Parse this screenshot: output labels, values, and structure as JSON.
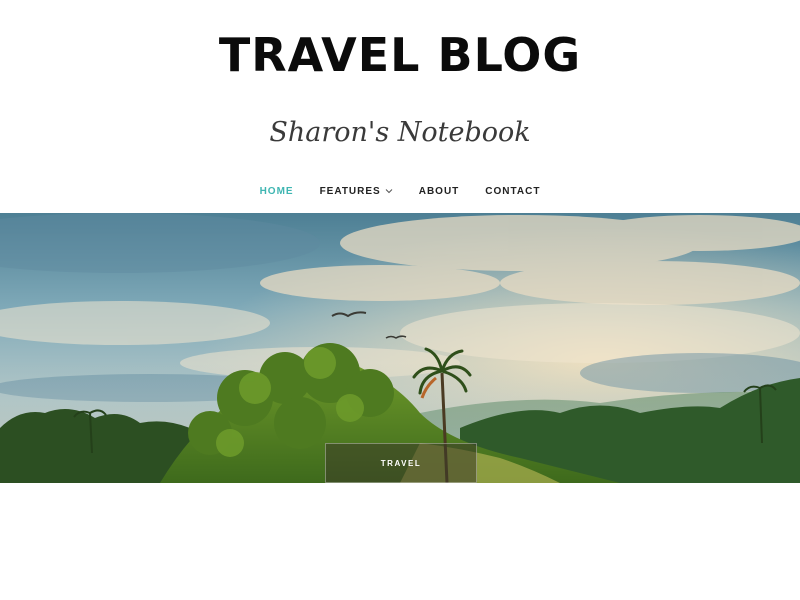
{
  "site": {
    "title": "TRAVEL BLOG",
    "tagline": "Sharon's Notebook"
  },
  "nav": {
    "items": [
      {
        "label": "HOME",
        "active": true
      },
      {
        "label": "FEATURES",
        "has_dropdown": true
      },
      {
        "label": "ABOUT"
      },
      {
        "label": "CONTACT"
      }
    ]
  },
  "hero": {
    "category_label": "TRAVEL"
  },
  "colors": {
    "accent": "#3fb6b2",
    "text": "#0b0b0b",
    "nav_text": "#222222"
  }
}
